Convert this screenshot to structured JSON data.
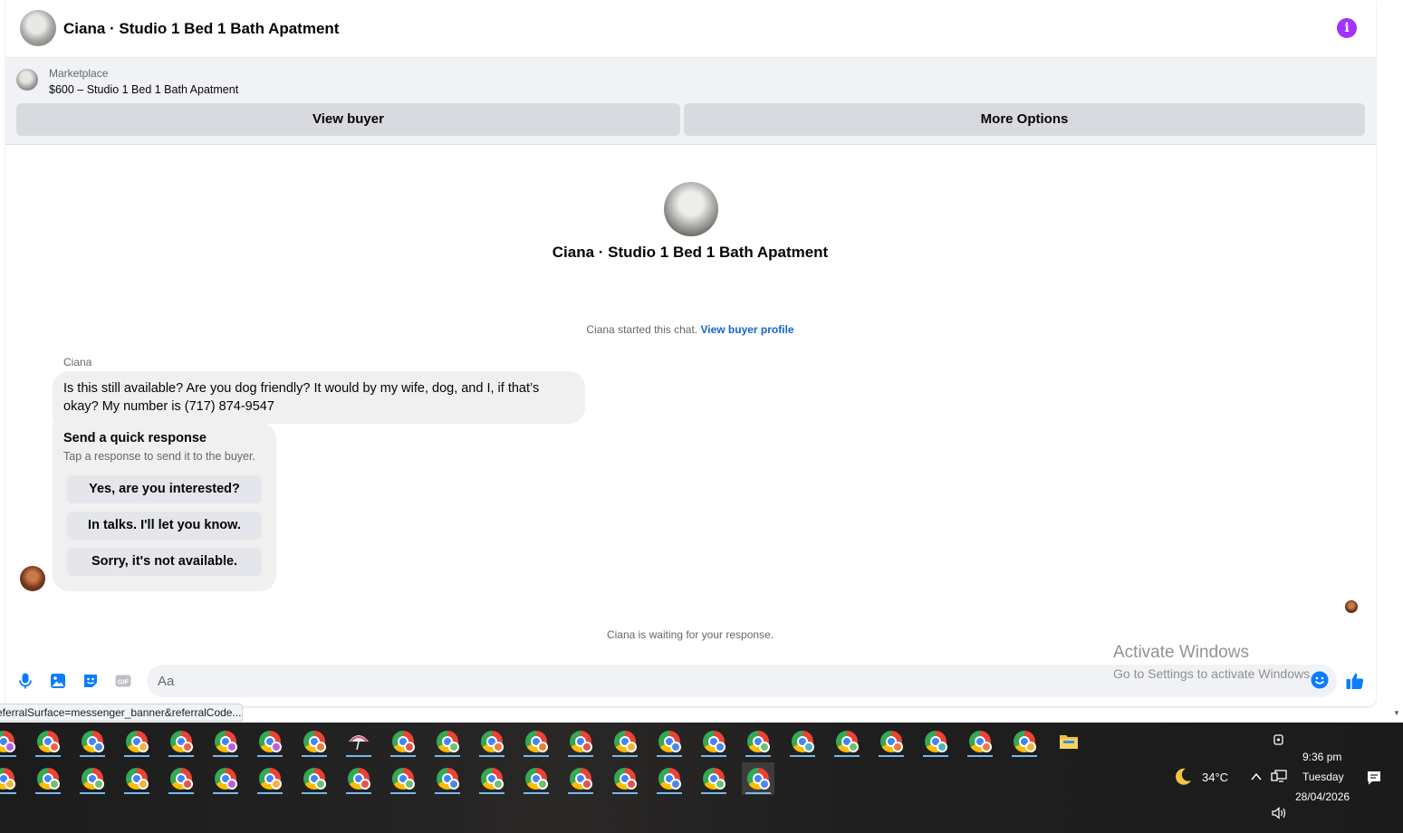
{
  "header": {
    "title": "Ciana · Studio 1 Bed 1 Bath Apatment",
    "info_icon": "info-icon",
    "accent": "#a033ff"
  },
  "listing": {
    "source": "Marketplace",
    "price_title": "$600 – Studio 1 Bed 1 Bath Apatment",
    "view_buyer_label": "View buyer",
    "more_options_label": "More Options"
  },
  "intro": {
    "title": "Ciana · Studio 1 Bed 1 Bath Apatment",
    "started_text": "Ciana started this chat. ",
    "profile_link": "View buyer profile"
  },
  "message": {
    "sender": "Ciana",
    "text": "Is this still available? Are you dog friendly? It would by my wife, dog, and I, if that’s okay? My number is (717) 874-9547"
  },
  "quick_response": {
    "title": "Send a quick response",
    "subtitle": "Tap a response to send it to the buyer.",
    "options": [
      "Yes, are you interested?",
      "In talks. I'll let you know.",
      "Sorry, it's not available."
    ]
  },
  "waiting_text": "Ciana is waiting for your response.",
  "composer": {
    "placeholder": "Aa",
    "icons": [
      "microphone-icon",
      "photo-icon",
      "sticker-icon",
      "gif-icon",
      "emoji-icon",
      "thumbs-up-icon"
    ],
    "accent": "#0a7cff"
  },
  "watermark": {
    "title": "Activate Windows",
    "subtitle": "Go to Settings to activate Windows."
  },
  "status_url": "eferralSurface=messenger_banner&referralCode...",
  "taskbar": {
    "row1_badges": [
      "#c05cdf",
      "#f0623a",
      "#4f86e6",
      "#f5b23b",
      "#f0623a",
      "#c05cdf",
      "#c05cdf",
      "#f07a3a",
      "umbrella",
      "#e8524a",
      "#6cc070",
      "#f07a3a",
      "#f07a3a",
      "#e8524a",
      "#f5b23b",
      "#4f86e6",
      "#4f86e6",
      "#6cc070",
      "#4fb3c6",
      "#6cc070",
      "#f07a3a",
      "#4fb3c6",
      "#f07a3a",
      "#f5b23b",
      "folder"
    ],
    "row2_badges": [
      "#f5b23b",
      "#6cc070",
      "#6cc070",
      "#f5b23b",
      "#e8524a",
      "#c05cdf",
      "#f5b23b",
      "#6cc070",
      "#e8524a",
      "#6cc070",
      "#4f86e6",
      "#6cc070",
      "#6cc070",
      "#e8524a",
      "#e8524a",
      "#4f86e6",
      "#6cc070",
      "#4f86e6"
    ],
    "weather_icon": "moon-icon",
    "temperature": "34°C",
    "time": "9:36 pm",
    "day": "Tuesday",
    "date": "28/04/2026"
  }
}
